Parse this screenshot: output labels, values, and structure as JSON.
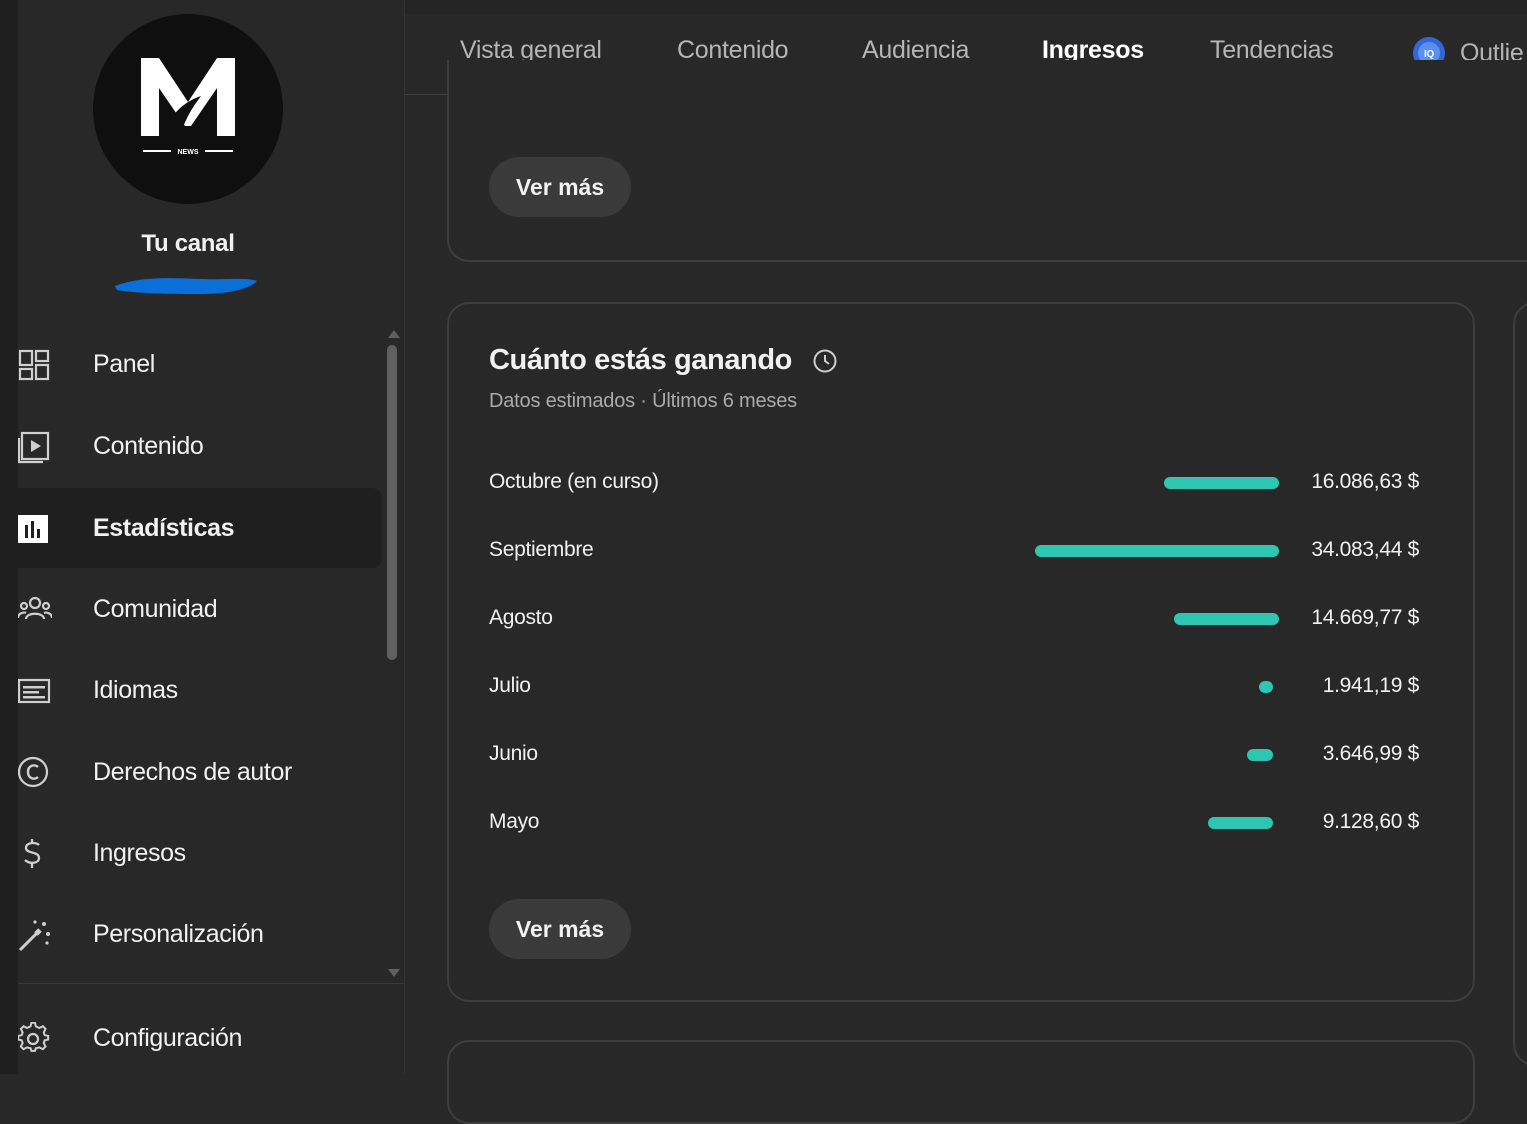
{
  "sidebar": {
    "channel_title": "Tu canal",
    "logo_text": "NEWS",
    "items": [
      {
        "label": "Panel",
        "icon": "dashboard-icon"
      },
      {
        "label": "Contenido",
        "icon": "video-content-icon"
      },
      {
        "label": "Estadísticas",
        "icon": "analytics-icon",
        "active": true
      },
      {
        "label": "Comunidad",
        "icon": "community-icon"
      },
      {
        "label": "Idiomas",
        "icon": "subtitles-icon"
      },
      {
        "label": "Derechos de autor",
        "icon": "copyright-icon"
      },
      {
        "label": "Ingresos",
        "icon": "dollar-icon"
      },
      {
        "label": "Personalización",
        "icon": "magic-wand-icon"
      },
      {
        "label": "Configuración",
        "icon": "gear-icon"
      }
    ]
  },
  "tabs": [
    {
      "label": "Vista general"
    },
    {
      "label": "Contenido"
    },
    {
      "label": "Audiencia"
    },
    {
      "label": "Ingresos",
      "active": true
    },
    {
      "label": "Tendencias"
    },
    {
      "label": "Outlie",
      "icon": "outlier-icon"
    }
  ],
  "top_card": {
    "button": "Ver más"
  },
  "earnings": {
    "title": "Cuánto estás ganando",
    "subtitle": "Datos estimados · Últimos 6 meses",
    "button": "Ver más",
    "rows": [
      {
        "month": "Octubre (en curso)",
        "value_label": "16.086,63 $"
      },
      {
        "month": "Septiembre",
        "value_label": "34.083,44 $"
      },
      {
        "month": "Agosto",
        "value_label": "14.669,77 $"
      },
      {
        "month": "Julio",
        "value_label": "1.941,19 $"
      },
      {
        "month": "Junio",
        "value_label": "3.646,99 $"
      },
      {
        "month": "Mayo",
        "value_label": "9.128,60 $"
      }
    ]
  },
  "chart_data": {
    "type": "bar",
    "categories": [
      "Octubre (en curso)",
      "Septiembre",
      "Agosto",
      "Julio",
      "Junio",
      "Mayo"
    ],
    "values": [
      16086.63,
      34083.44,
      14669.77,
      1941.19,
      3646.99,
      9128.6
    ],
    "title": "Cuánto estás ganando",
    "subtitle": "Datos estimados · Últimos 6 meses"
  },
  "colors": {
    "accent_bar": "#2ec5b3",
    "background": "#282828",
    "scribble": "#0a6fd6"
  }
}
